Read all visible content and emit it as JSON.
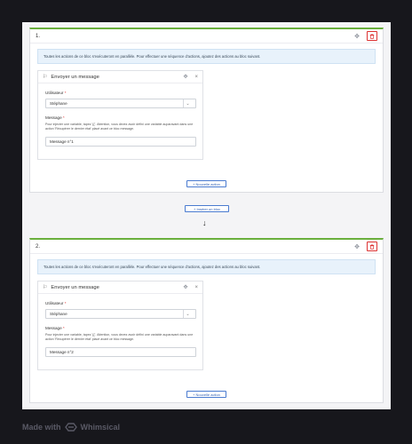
{
  "info_text": "Toutes les actions de ce bloc s'exécuteront en parallèle. Pour effectuer une séquence d'actions, ajoutez des actions au bloc suivant.",
  "blocks": [
    {
      "number": "1.",
      "action": {
        "title": "Envoyer un message",
        "user_label": "Utilisateur",
        "user_value": "Stéphane",
        "message_label": "Message",
        "help": "Pour injecter une variable, tapez '{{'. Attention, vous devez avoir défini une variable auparavant dans une action 'Récupérer le dernier état' placé avant ce bloc message.",
        "message_value": "Message n°1"
      },
      "new_action_label": "+ Nouvelle action"
    },
    {
      "number": "2.",
      "action": {
        "title": "Envoyer un message",
        "user_label": "Utilisateur",
        "user_value": "Stéphane",
        "message_label": "Message",
        "help": "Pour injecter une variable, tapez '{{'. Attention, vous devez avoir défini une variable auparavant dans une action 'Récupérer le dernier état' placé avant ce bloc message.",
        "message_value": "Message n°2"
      },
      "new_action_label": "+ Nouvelle action"
    }
  ],
  "insert_block_label": "+ Insérer un bloc",
  "arrow_glyph": "↓",
  "required_mark": "*",
  "icons": {
    "drag": "✥",
    "close": "×",
    "chevron": "⌄",
    "trash": "trash-icon",
    "message": "⚐"
  },
  "watermark": {
    "prefix": "Made with",
    "brand": "Whimsical"
  },
  "colors": {
    "accent_green": "#6aaf3d",
    "danger": "#dd3333",
    "link_blue": "#2f5fb3"
  }
}
